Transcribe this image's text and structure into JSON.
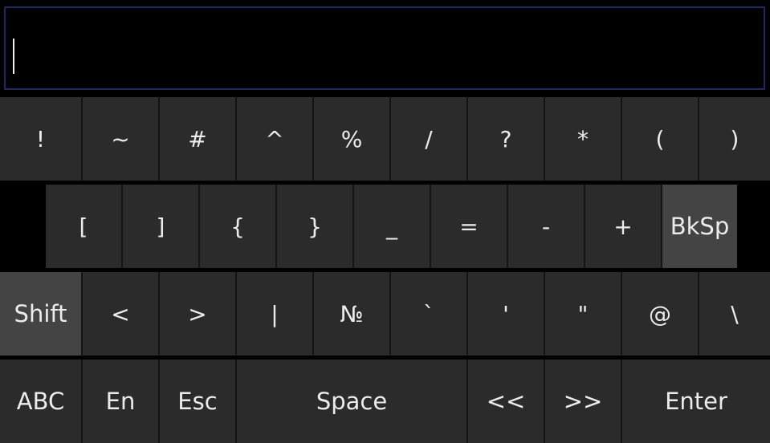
{
  "input": {
    "value": ""
  },
  "rows": {
    "row1": [
      "!",
      "~",
      "#",
      "^",
      "%",
      "/",
      "?",
      "*",
      "(",
      ")"
    ],
    "row2": [
      "[",
      "]",
      "{",
      "}",
      "_",
      "=",
      "-",
      "+",
      "BkSp"
    ],
    "row3": [
      "Shift",
      "<",
      ">",
      "|",
      "№",
      "`",
      "'",
      "\"",
      "@",
      "\\"
    ],
    "row4": [
      "ABC",
      "En",
      "Esc",
      "Space",
      "<<",
      ">>",
      "Enter"
    ]
  },
  "colors": {
    "key": "#2b2b2b",
    "key_highlight": "#444444",
    "background": "#000000",
    "input_border": "#1b2a66"
  }
}
